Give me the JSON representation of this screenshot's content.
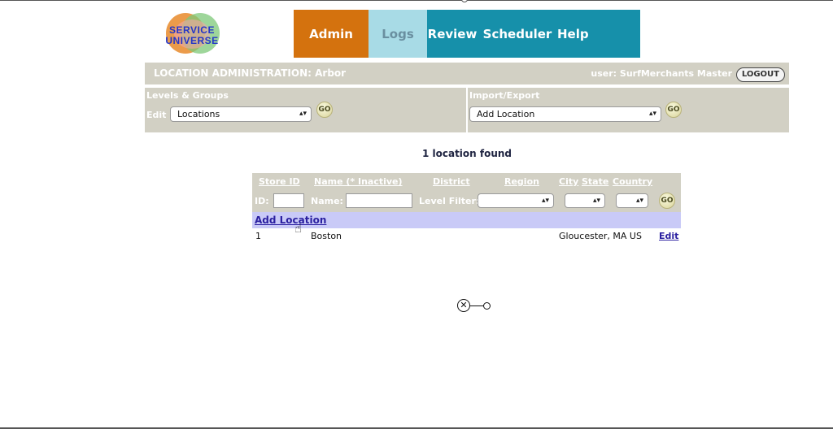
{
  "logo": {
    "line1": "SERVICE",
    "line2": "UNIVERSE"
  },
  "nav": {
    "tabs": [
      "Admin",
      "Logs",
      "Review",
      "Scheduler",
      "Help"
    ]
  },
  "header": {
    "title": "LOCATION ADMINISTRATION: Arbor",
    "user": "user: SurfMerchants Master",
    "logout": "LOGOUT"
  },
  "levels": {
    "title": "Levels & Groups",
    "edit_label": "Edit",
    "selected": "Locations",
    "go": "GO"
  },
  "import_export": {
    "title": "Import/Export",
    "selected": "Add Location",
    "go": "GO"
  },
  "results": {
    "found_text": "1 location found"
  },
  "table": {
    "headers": [
      "Store ID",
      "Name (* Inactive)",
      "District",
      "Region",
      "City",
      "State",
      "Country"
    ],
    "filters": {
      "id_label": "ID:",
      "name_label": "Name:",
      "level_filter_label": "Level Filter:",
      "go": "GO"
    },
    "add_location": "Add Location",
    "rows": [
      {
        "id": "1",
        "name": "Boston",
        "location": "Gloucester, MA US",
        "action": "Edit"
      }
    ]
  },
  "colors": {
    "admin": "#d4720e",
    "logs": "#a8dbe6",
    "nav": "#1690aa",
    "panel": "#d2d0c4",
    "add_row": "#c9caf7"
  }
}
